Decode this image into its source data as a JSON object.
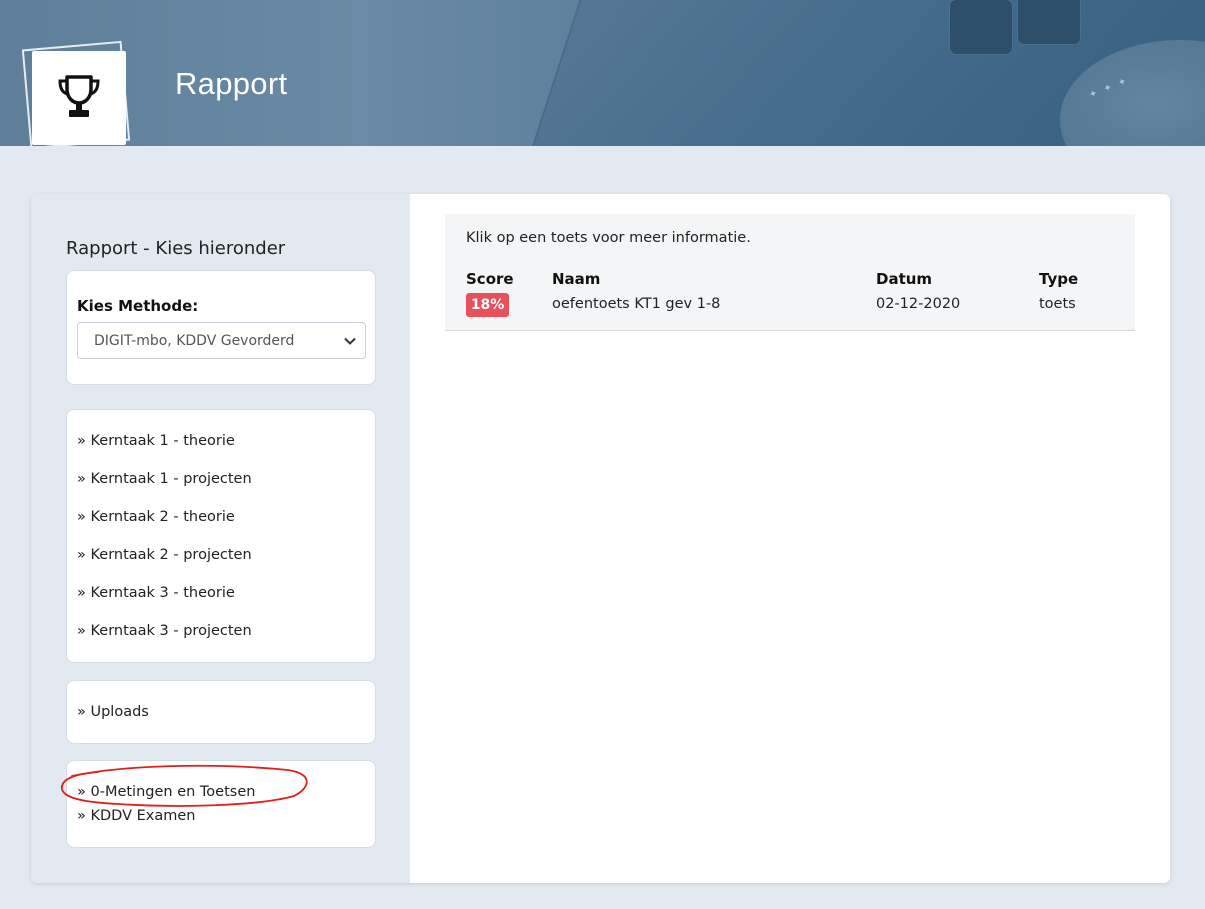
{
  "header": {
    "title": "Rapport",
    "logo_icon": "trophy-icon"
  },
  "sidebar": {
    "heading": "Rapport - Kies hieronder",
    "methode": {
      "label": "Kies Methode:",
      "selected": "DIGIT-mbo, KDDV Gevorderd"
    },
    "kerntaken": [
      "» Kerntaak 1 - theorie",
      "» Kerntaak 1 - projecten",
      "» Kerntaak 2 - theorie",
      "» Kerntaak 2 - projecten",
      "» Kerntaak 3 - theorie",
      "» Kerntaak 3 - projecten"
    ],
    "uploads": "» Uploads",
    "toetsen": [
      "» 0-Metingen en Toetsen",
      "» KDDV Examen"
    ]
  },
  "results": {
    "info": "Klik op een toets voor meer informatie.",
    "columns": [
      "Score",
      "Naam",
      "Datum",
      "Type"
    ],
    "rows": [
      {
        "score": "18%",
        "naam": "oefentoets KT1 gev 1-8",
        "datum": "02-12-2020",
        "type": "toets"
      }
    ]
  },
  "colors": {
    "score_badge": "#e8505b",
    "annotation": "#e0201a",
    "background": "#e3e9f0"
  }
}
